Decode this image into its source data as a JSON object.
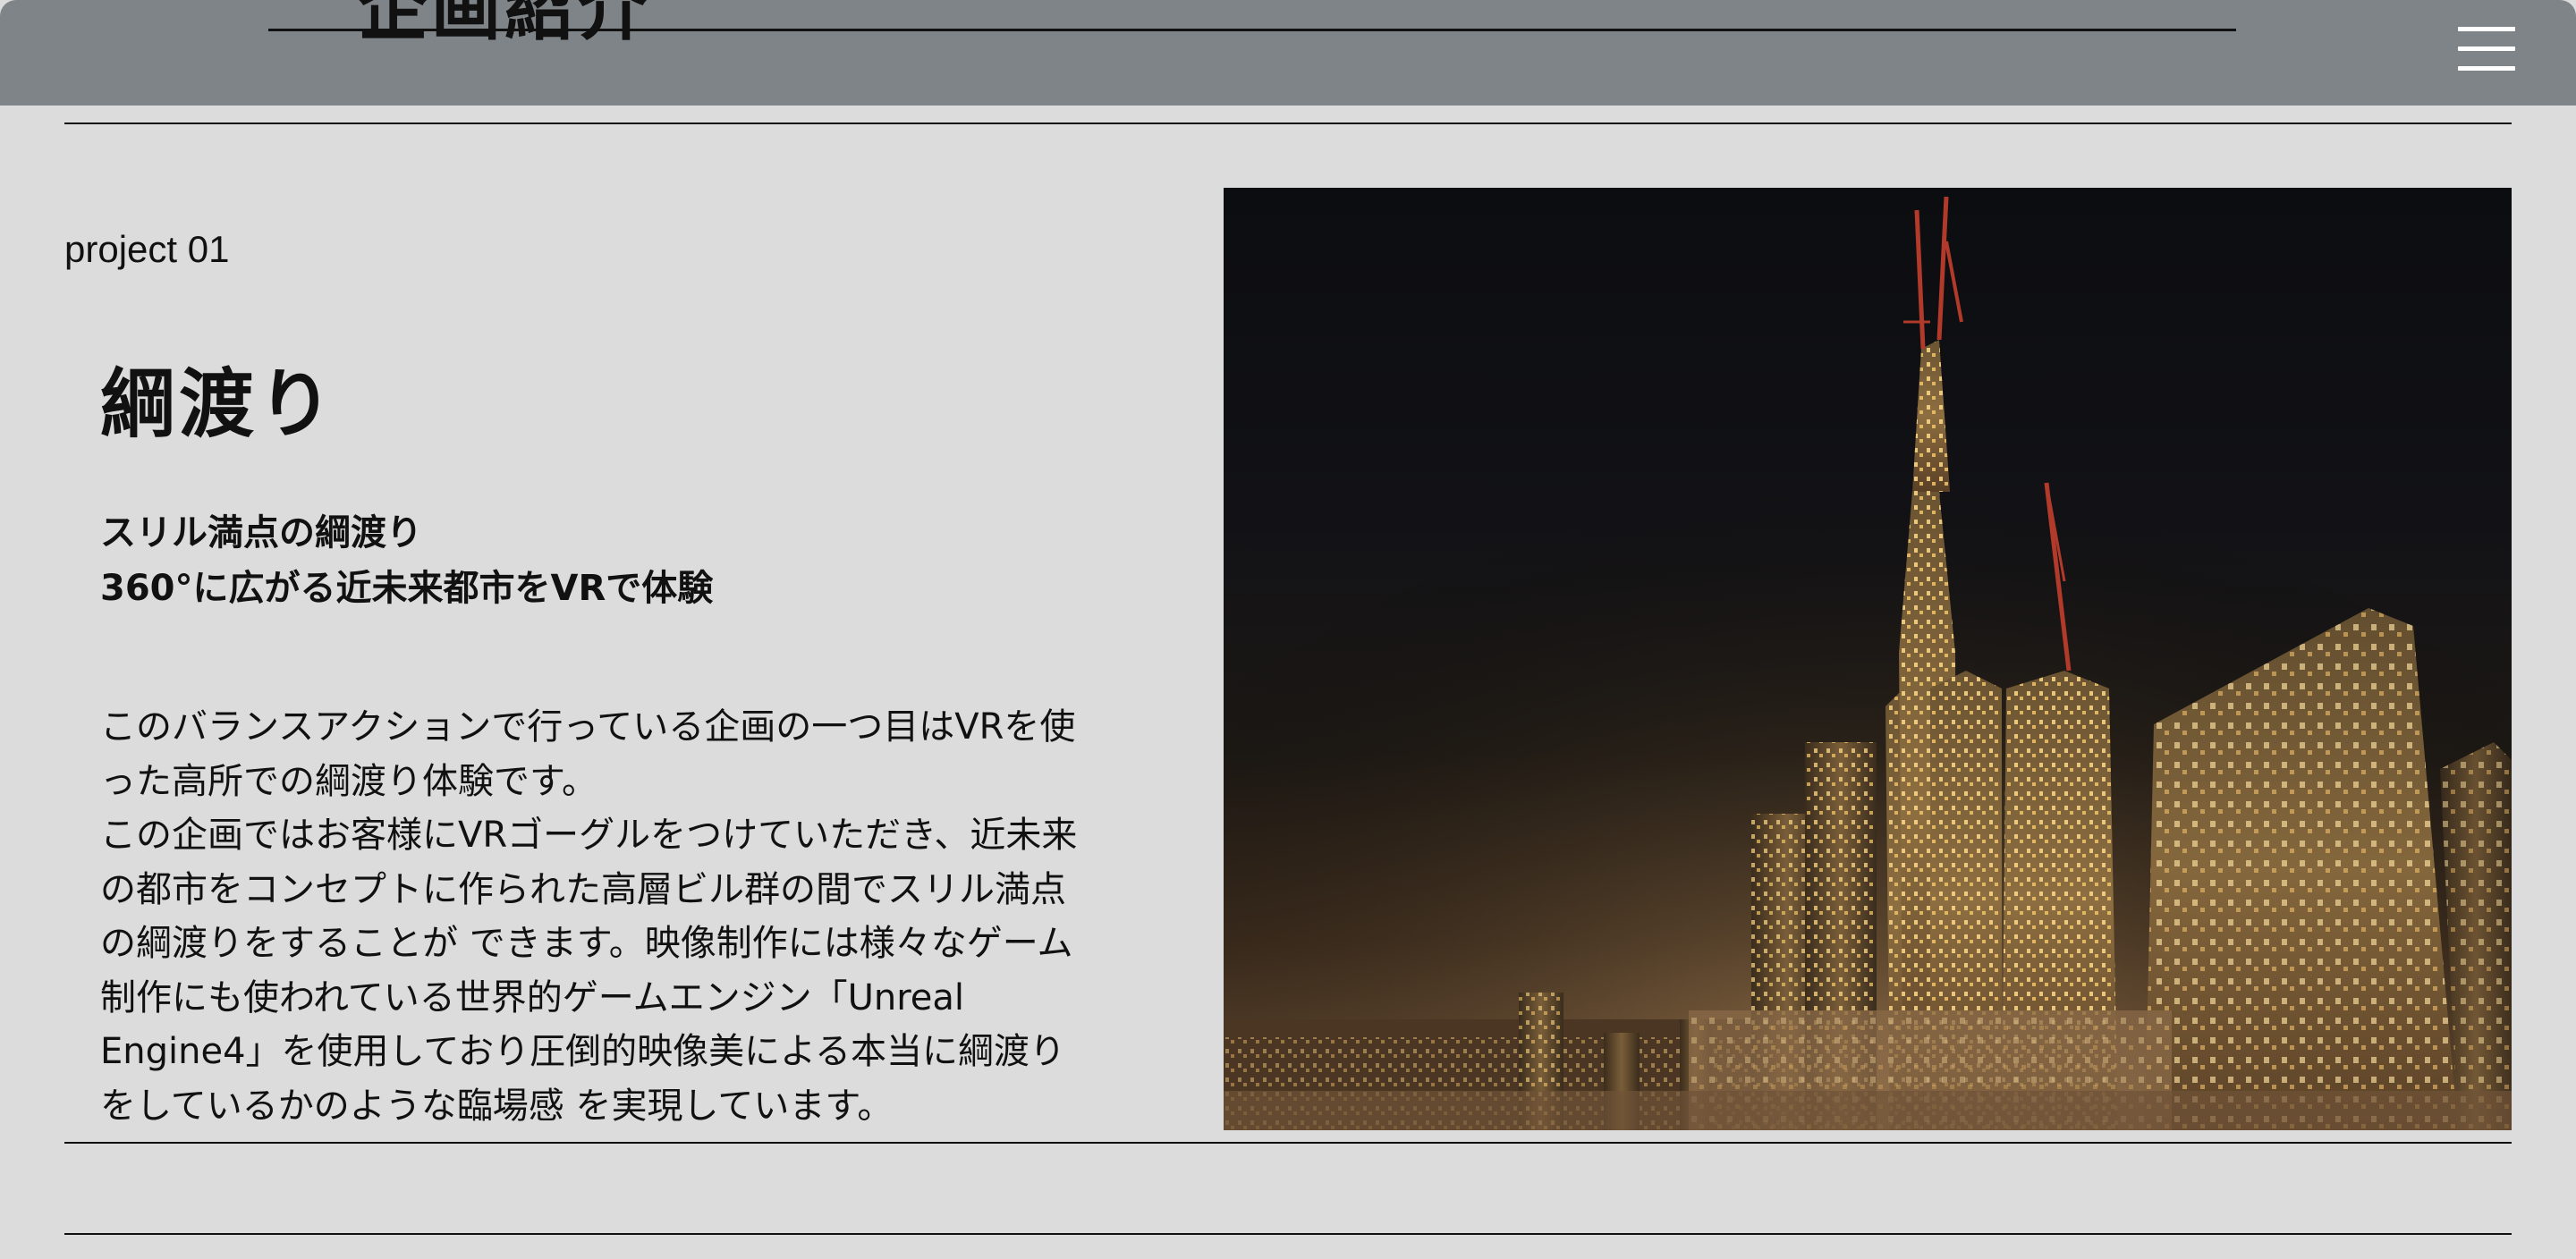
{
  "header": {
    "title": "企画紹介",
    "menu_icon": "hamburger-menu-icon"
  },
  "project": {
    "number_label": "project 01",
    "title": "綱渡り",
    "subtitle_lines": [
      "スリル満点の綱渡り",
      "360°に広がる近未来都市をVRで体験"
    ],
    "body_lines": [
      "このバランスアクションで行っている企画の一つ目はVRを使",
      "った高所での綱渡り体験です。",
      "この企画ではお客様にVRゴーグルをつけていただき、近未来",
      "の都市をコンセプトに作られた高層ビル群の間でスリル満点",
      "の綱渡りをすることが できます。映像制作には様々なゲーム",
      "制作にも使われている世界的ゲームエンジン「Unreal",
      "Engine4」を使用しており圧倒的映像美による本当に綱渡り",
      "をしているかのような臨場感 を実現しています。"
    ]
  },
  "colors": {
    "page_background": "#dcdcdc",
    "header_background": "#7f8488",
    "text": "#111111",
    "menu_icon": "#ffffff"
  }
}
